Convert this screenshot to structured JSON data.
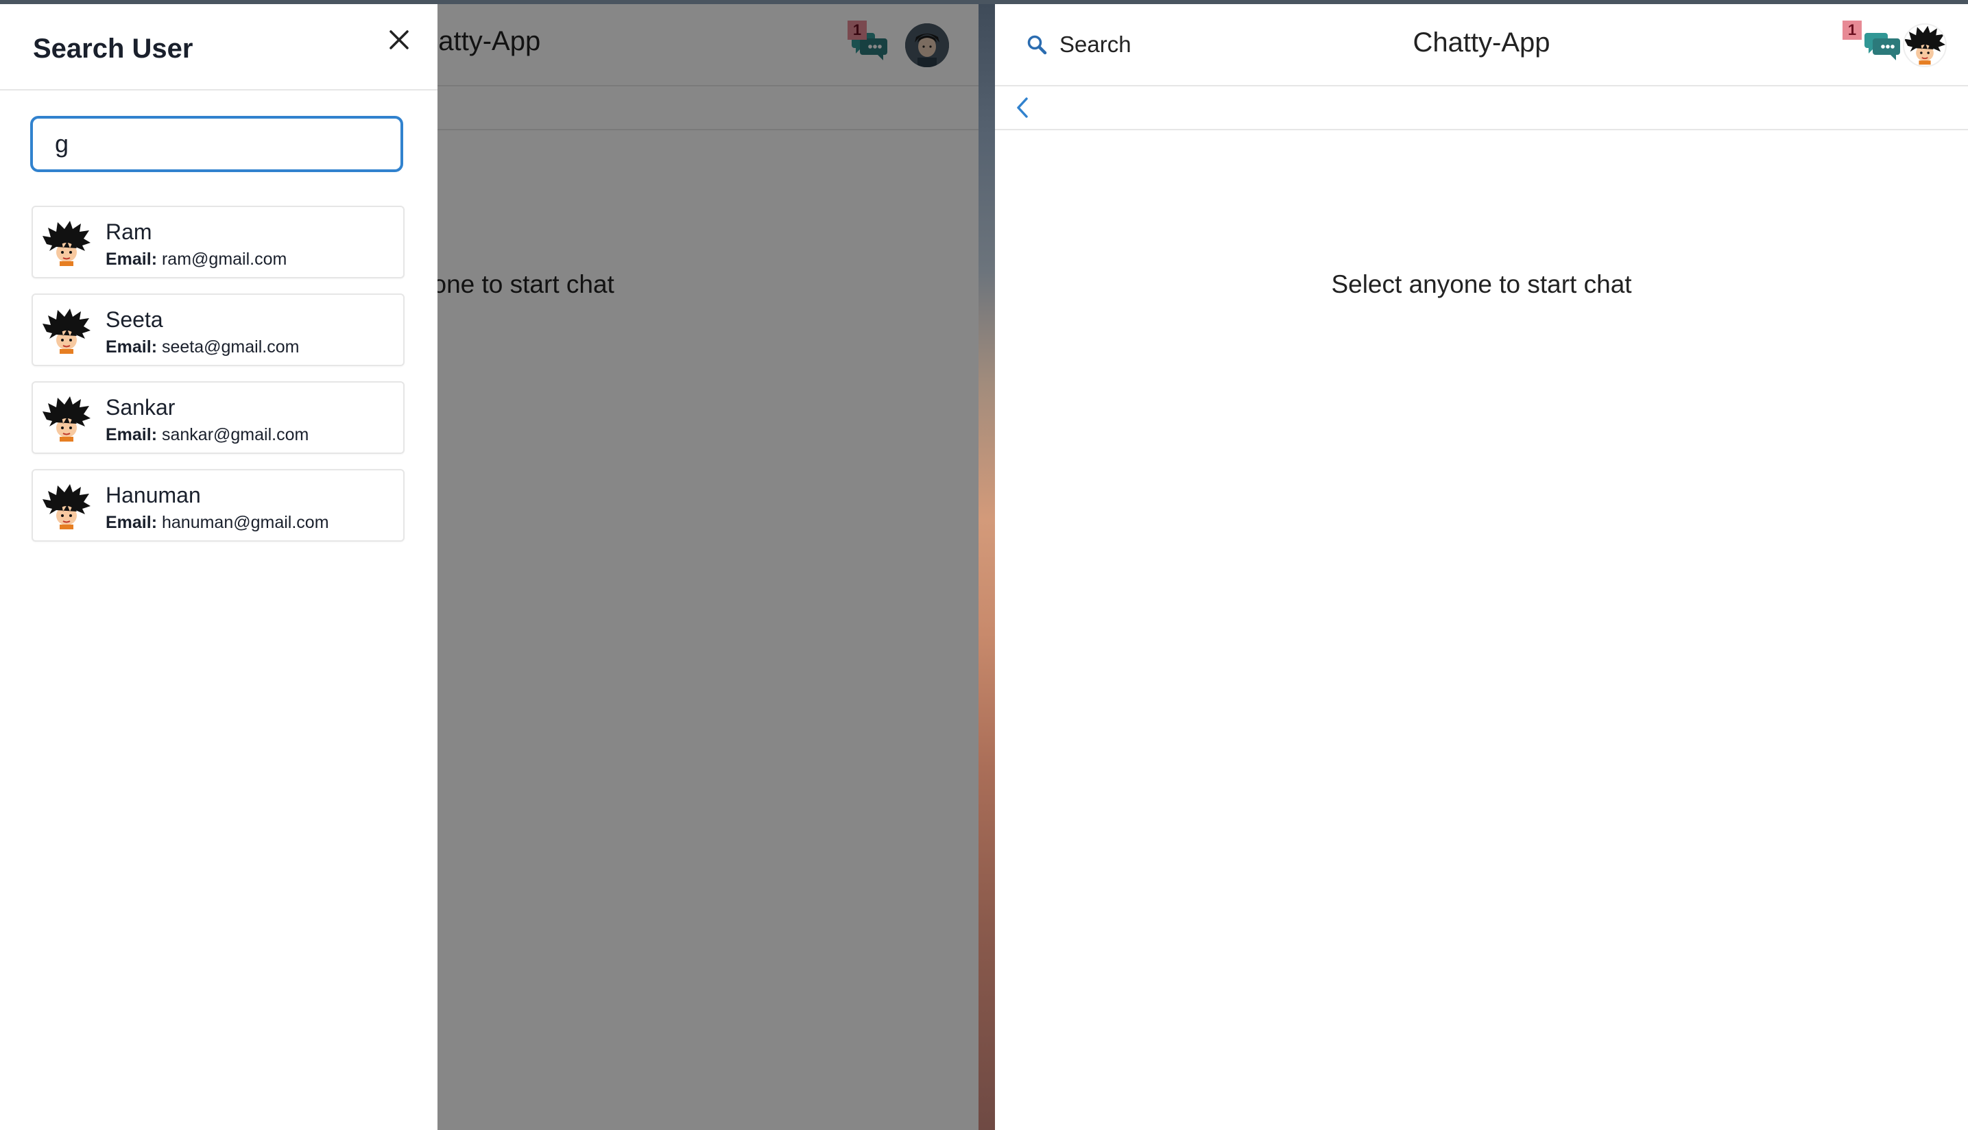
{
  "app": {
    "title": "Chatty-App",
    "empty_message": "Select anyone to start chat"
  },
  "left_window": {
    "title_partial": "hatty-App",
    "empty_partial": "yone to start chat"
  },
  "header": {
    "search_label": "Search",
    "notification_count": "1"
  },
  "drawer": {
    "title": "Search User",
    "search_value": "g",
    "email_label": "Email:",
    "users": [
      {
        "name": "Ram",
        "email": "ram@gmail.com"
      },
      {
        "name": "Seeta",
        "email": "seeta@gmail.com"
      },
      {
        "name": "Sankar",
        "email": "sankar@gmail.com"
      },
      {
        "name": "Hanuman",
        "email": "hanuman@gmail.com"
      }
    ]
  },
  "icons": {
    "close": "close-icon",
    "search": "search-icon",
    "chat": "chat-bubbles-icon",
    "back": "chevron-left-icon",
    "avatar": "avatar-icon"
  },
  "colors": {
    "accent": "#3182ce",
    "chat_icon": "#319795",
    "badge": "#e78a95",
    "overlay": "#000000"
  }
}
